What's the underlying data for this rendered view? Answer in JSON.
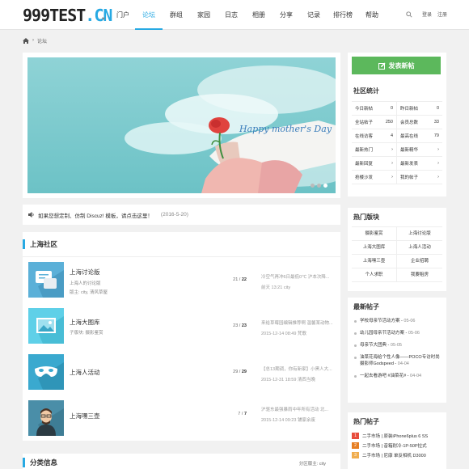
{
  "header": {
    "logo_main": "999TEST",
    "logo_dot": ".",
    "logo_cn": "CN",
    "nav": [
      "门户",
      "论坛",
      "群组",
      "家园",
      "日志",
      "相册",
      "分享",
      "记录",
      "排行榜",
      "帮助"
    ],
    "active_nav": "论坛",
    "login": "登录",
    "register": "注册"
  },
  "breadcrumb": {
    "sep": "›",
    "current": "论坛"
  },
  "banner": {
    "caption": "Happy mother's Day"
  },
  "notice": {
    "text": "如果您想定制、仿制 Discuz! 模板，请点击这里！",
    "date": "(2016-5-20)"
  },
  "community": {
    "title": "上海社区",
    "forums": [
      {
        "name": "上海讨论版",
        "desc": "上海人的讨论版",
        "mod": "版主: city, 清风草屋",
        "threads": "21",
        "posts": "22",
        "last_title": "冷空气再冲6日最低0℃ 沪本次降...",
        "last_time": "前天 13:21 city"
      },
      {
        "name": "上海大图库",
        "desc": "子版块: 摄影鉴赏",
        "mod": "",
        "threads": "23",
        "posts": "23",
        "last_title": "来给草莓园编辑推荐啊 温馨某动物...",
        "last_time": "2015-12-14 08:49 梵歌"
      },
      {
        "name": "上海人活动",
        "desc": "",
        "mod": "",
        "threads": "29",
        "posts": "29",
        "last_title": "【总13期调，你有新家】小黑人大...",
        "last_time": "2015-12-31 18:59 清西当晚"
      },
      {
        "name": "上海嘿三壶",
        "desc": "",
        "mod": "",
        "threads": "7",
        "posts": "7",
        "last_title": "沪驱东最强暴雨中年所有活动 北...",
        "last_time": "2015-12-14 09:23 铺家余废"
      }
    ]
  },
  "classified": {
    "title": "分类信息",
    "moderator": "分区版主: city"
  },
  "sidebar": {
    "post_button": "发表新帖",
    "stats_title": "社区统计",
    "stats": [
      {
        "label": "今日新帖",
        "value": "0"
      },
      {
        "label": "昨日新帖",
        "value": "0"
      },
      {
        "label": "全站帖子",
        "value": "250"
      },
      {
        "label": "会员总数",
        "value": "33"
      },
      {
        "label": "在线访客",
        "value": "4"
      },
      {
        "label": "最高在线",
        "value": "79"
      },
      {
        "label": "最新热门",
        "value": "›"
      },
      {
        "label": "最新精华",
        "value": "›"
      },
      {
        "label": "最新回复",
        "value": "›"
      },
      {
        "label": "最新发表",
        "value": "›"
      },
      {
        "label": "抢楼沙发",
        "value": "›"
      },
      {
        "label": "我的帖子",
        "value": "›"
      }
    ],
    "hot_boards_title": "热门版块",
    "hot_boards": [
      "摄影鉴赏",
      "上海讨论版",
      "上海大图库",
      "上海人活动",
      "上海嘿三壶",
      "企业招聘",
      "个人求职",
      "我要租房"
    ],
    "latest_title": "最新帖子",
    "latest": [
      {
        "t": "学校母亲节活动方案",
        "d": "05-06"
      },
      {
        "t": "幼儿园母亲节活动方案",
        "d": "05-06"
      },
      {
        "t": "母亲节大团典",
        "d": "05-05"
      },
      {
        "t": "油菜花海给个性人像——POCO专访时尚摄影师Godspeed",
        "d": "04-04"
      },
      {
        "t": "一起去看游吧 #油菜花#",
        "d": "04-04"
      }
    ],
    "hot_posts_title": "热门帖子",
    "hot_posts": [
      {
        "rank": "1",
        "t": "二手市场 | 原装iPhone6plus 6 SS",
        "color": "#e74c3c"
      },
      {
        "rank": "2",
        "t": "二手市场 | 音箱耐冷-1P-50P拉式",
        "color": "#e67e22"
      },
      {
        "rank": "3",
        "t": "二手市场 | 尼康 单反相机 D3000",
        "color": "#f0ad4e"
      }
    ]
  },
  "colors": {
    "accent": "#27a9e3",
    "post_button": "#5cb85c"
  }
}
